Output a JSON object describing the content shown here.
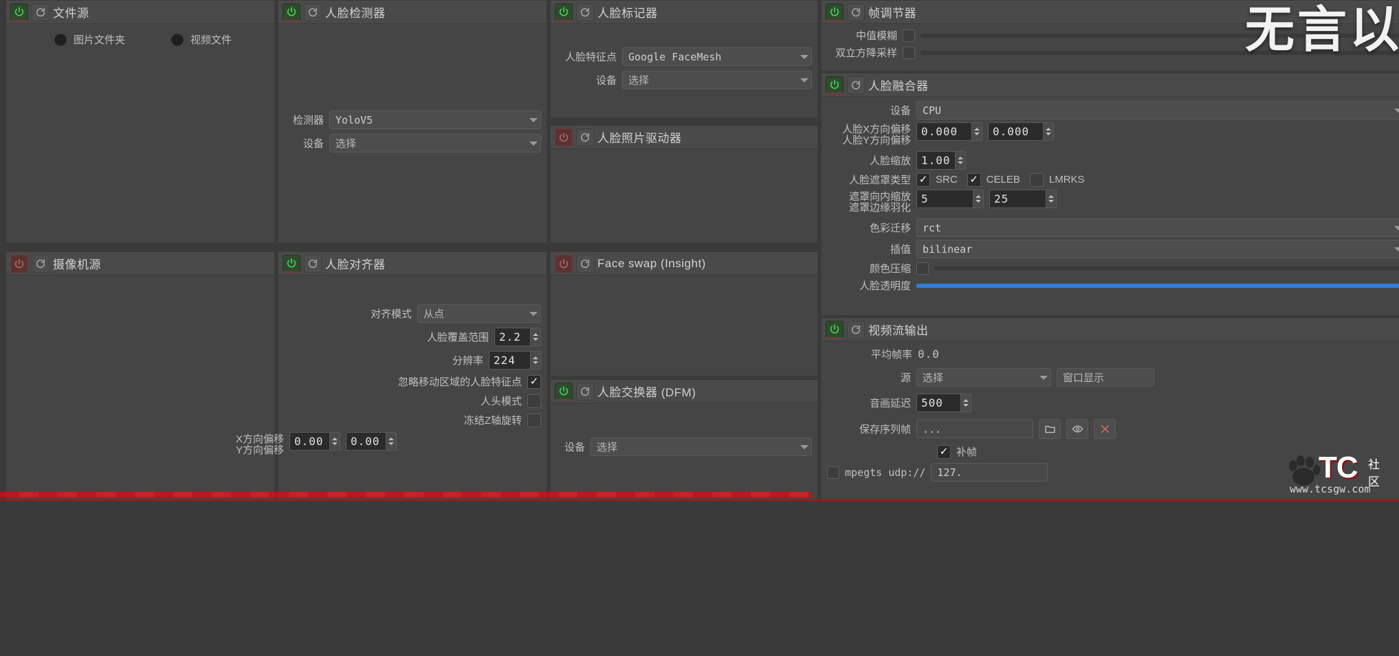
{
  "app": {
    "watermark_title": "无言以",
    "badge": {
      "name": "TC",
      "suffix": "社区",
      "url": "www.tcsgw.com"
    }
  },
  "modules": {
    "file_source": {
      "title": "文件源",
      "power_on": true,
      "options": [
        {
          "label": "图片文件夹",
          "selected": false
        },
        {
          "label": "视频文件",
          "selected": false
        }
      ]
    },
    "camera_source": {
      "title": "摄像机源",
      "power_on": false
    },
    "face_detector": {
      "title": "人脸检测器",
      "power_on": true,
      "rows": [
        {
          "label": "检测器",
          "value": "YoloV5"
        },
        {
          "label": "设备",
          "value": "选择"
        }
      ]
    },
    "face_aligner": {
      "title": "人脸对齐器",
      "power_on": true,
      "align_mode": {
        "label": "对齐模式",
        "value": "从点"
      },
      "coverage": {
        "label": "人脸覆盖范围",
        "value": "2.2"
      },
      "resolution": {
        "label": "分辨率",
        "value": "224"
      },
      "ignore_moving": {
        "label": "忽略移动区域的人脸特征点",
        "checked": true
      },
      "head_mode": {
        "label": "人头模式",
        "checked": false
      },
      "freeze_z": {
        "label": "冻结Z轴旋转",
        "checked": false
      },
      "offset_x": {
        "label": "X方向偏移",
        "value": "0.00"
      },
      "offset_y": {
        "label": "Y方向偏移",
        "value": "0.00"
      }
    },
    "face_marker": {
      "title": "人脸标记器",
      "power_on": true,
      "landmarks": {
        "label": "人脸特征点",
        "value": "Google FaceMesh"
      },
      "device": {
        "label": "设备",
        "value": "选择"
      }
    },
    "face_animator": {
      "title": "人脸照片驱动器",
      "power_on": false
    },
    "face_swap_insight": {
      "title": "Face swap (Insight)",
      "power_on": false
    },
    "face_swap_dfm": {
      "title": "人脸交换器 (DFM)",
      "power_on": true,
      "device": {
        "label": "设备",
        "value": "选择"
      }
    },
    "frame_adjuster": {
      "title": "帧调节器",
      "power_on": true,
      "median_blur": {
        "label": "中值模糊",
        "checked": false
      },
      "bicubic_downscale": {
        "label": "双立方降采样",
        "checked": false
      }
    },
    "face_merger": {
      "title": "人脸融合器",
      "power_on": true,
      "device": {
        "label": "设备",
        "value": "CPU"
      },
      "face_x_offset": {
        "label": "人脸X方向偏移",
        "value": "0.000"
      },
      "face_y_offset": {
        "label": "人脸Y方向偏移",
        "value": "0.000"
      },
      "face_scale": {
        "label": "人脸缩放",
        "value": "1.00"
      },
      "mask_type": {
        "label": "人脸遮罩类型",
        "items": [
          {
            "label": "SRC",
            "checked": true
          },
          {
            "label": "CELEB",
            "checked": true
          },
          {
            "label": "LMRKS",
            "checked": false
          }
        ]
      },
      "mask_erode": {
        "label": "遮罩向内缩放",
        "value": "5"
      },
      "mask_blur": {
        "label": "遮罩边缘羽化",
        "value": "25"
      },
      "color_transfer": {
        "label": "色彩迁移",
        "value": "rct"
      },
      "interpolation": {
        "label": "插值",
        "value": "bilinear"
      },
      "color_compression": {
        "label": "颜色压缩",
        "checked": false
      },
      "face_opacity": {
        "label": "人脸透明度",
        "value": 100
      }
    },
    "stream_output": {
      "title": "视频流输出",
      "power_on": true,
      "avg_fps": {
        "label": "平均帧率",
        "value": "0.0"
      },
      "source": {
        "label": "源",
        "value": "选择"
      },
      "window_show_button": "窗口显示",
      "av_delay": {
        "label": "音画延迟",
        "value": "500"
      },
      "save_sequence": {
        "label": "保存序列帧",
        "value": "...",
        "placeholder": "..."
      },
      "frame_fill": {
        "label": "补帧",
        "checked": true
      },
      "mpegts": {
        "label": "mpegts udp://",
        "checked": false,
        "value": "127."
      }
    }
  },
  "colors": {
    "accent_blue": "#2f7fd8",
    "power_green": "#49e05a",
    "panel_bg": "#454545",
    "header_bg": "#4a4a4a",
    "field_bg": "#4d4d4d",
    "number_bg": "#2b2b2b",
    "watermark_red": "#b01414"
  }
}
